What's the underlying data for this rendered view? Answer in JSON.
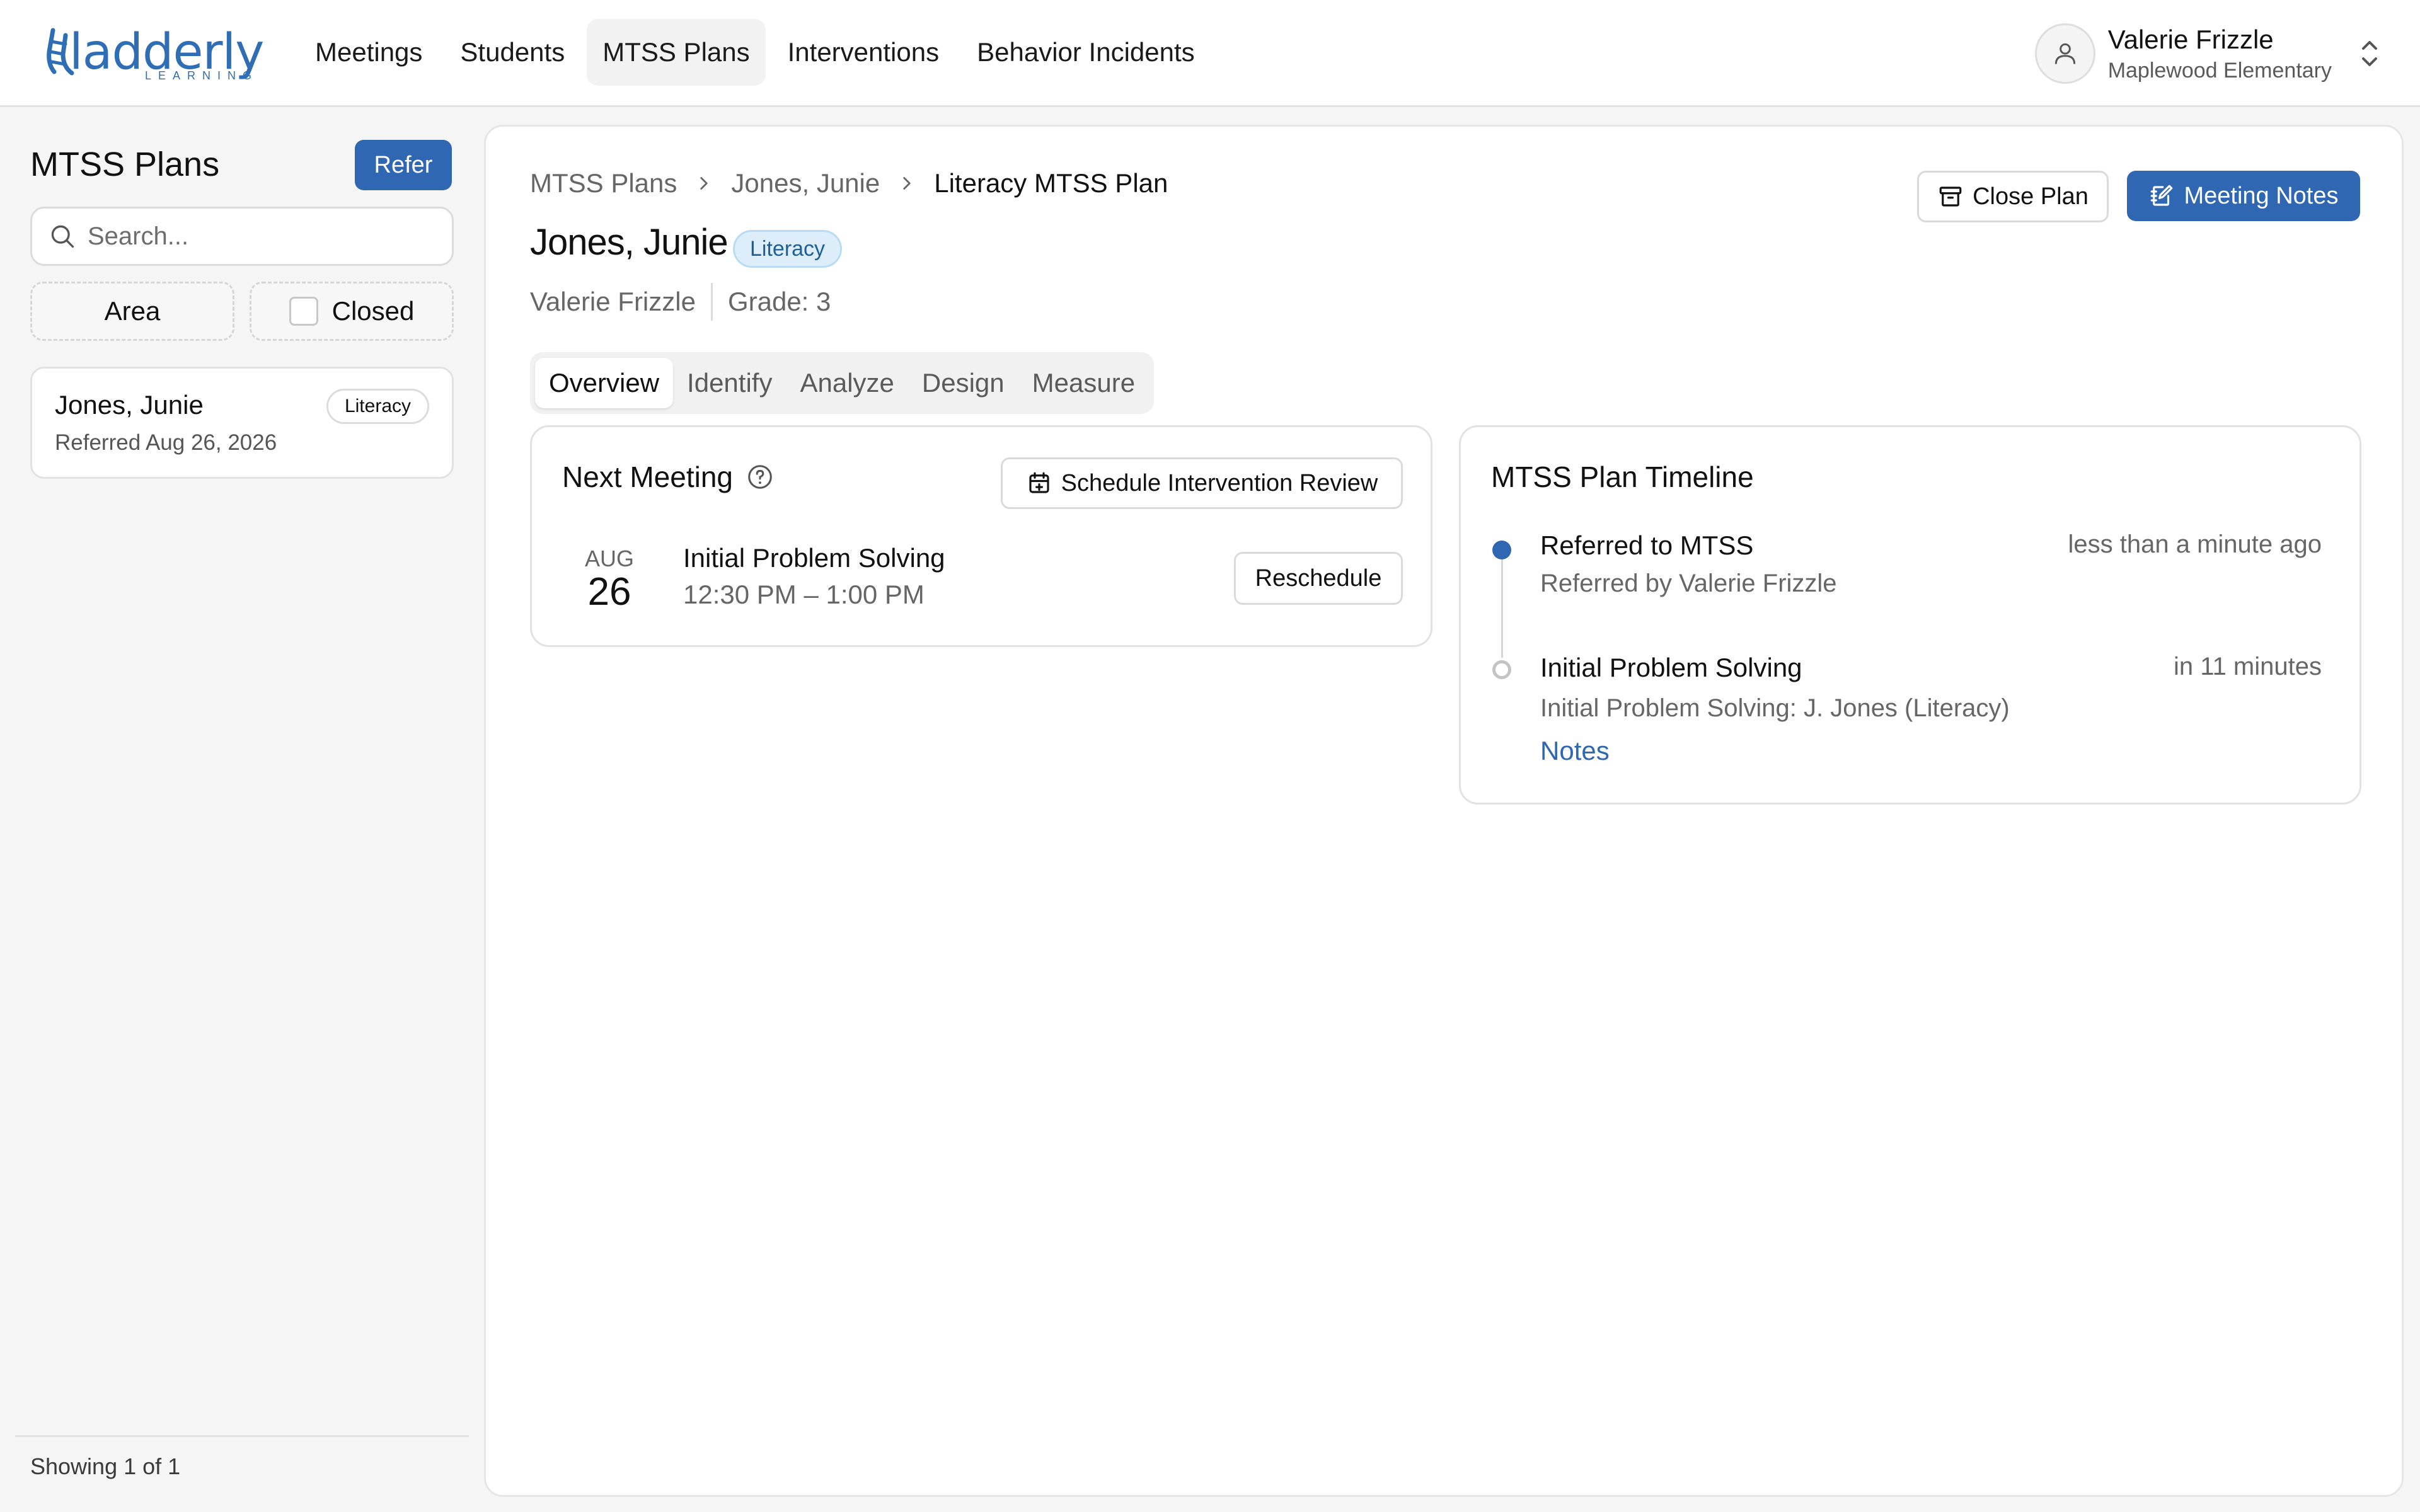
{
  "brand": {
    "name": "ladderly",
    "tagline": "LEARNING",
    "color": "#2f6db5"
  },
  "nav": {
    "items": [
      {
        "label": "Meetings"
      },
      {
        "label": "Students"
      },
      {
        "label": "MTSS Plans",
        "active": true
      },
      {
        "label": "Interventions"
      },
      {
        "label": "Behavior Incidents"
      }
    ]
  },
  "user": {
    "name": "Valerie Frizzle",
    "school": "Maplewood Elementary"
  },
  "sidebar": {
    "title": "MTSS Plans",
    "refer_label": "Refer",
    "search_placeholder": "Search...",
    "filters": {
      "area_label": "Area",
      "closed_label": "Closed"
    },
    "plans": [
      {
        "name": "Jones, Junie",
        "badge": "Literacy",
        "subtitle": "Referred Aug 26, 2026"
      }
    ],
    "footer": "Showing 1 of 1"
  },
  "main": {
    "breadcrumbs": [
      "MTSS Plans",
      "Jones, Junie",
      "Literacy MTSS Plan"
    ],
    "close_plan_label": "Close Plan",
    "meeting_notes_label": "Meeting Notes",
    "student_name": "Jones, Junie",
    "area_badge": "Literacy",
    "teacher": "Valerie Frizzle",
    "grade": "Grade: 3",
    "tabs": [
      {
        "label": "Overview",
        "active": true
      },
      {
        "label": "Identify"
      },
      {
        "label": "Analyze"
      },
      {
        "label": "Design"
      },
      {
        "label": "Measure"
      }
    ],
    "next_meeting": {
      "title": "Next Meeting",
      "schedule_label": "Schedule Intervention Review",
      "month": "AUG",
      "day": "26",
      "meeting_title": "Initial Problem Solving",
      "time": "12:30 PM – 1:00 PM",
      "reschedule_label": "Reschedule"
    },
    "timeline": {
      "title": "MTSS Plan Timeline",
      "events": [
        {
          "title": "Referred to MTSS",
          "subtitle": "Referred by Valerie Frizzle",
          "time": "less than a minute ago",
          "status": "done"
        },
        {
          "title": "Initial Problem Solving",
          "subtitle": "Initial Problem Solving: J. Jones (Literacy)",
          "time": "in 11 minutes",
          "status": "upcoming",
          "link": "Notes"
        }
      ]
    }
  },
  "colors": {
    "primary": "#2f67b3",
    "badge_bg": "#ddeefa",
    "badge_text": "#1f5f98"
  }
}
